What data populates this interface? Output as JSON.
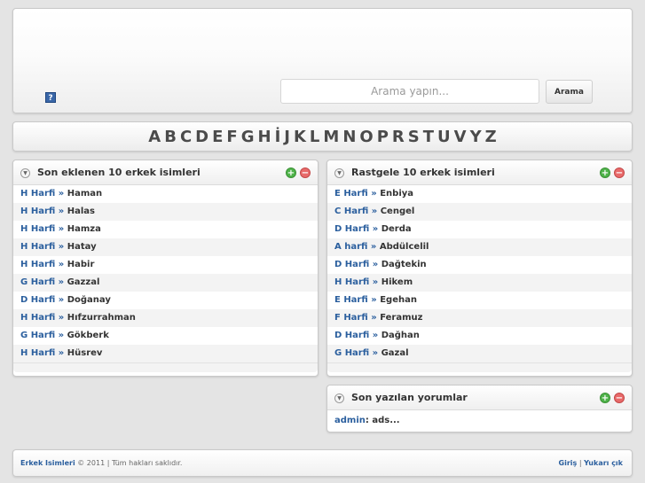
{
  "header": {
    "help_icon_glyph": "?",
    "search_placeholder": "Arama yapın...",
    "search_button": "Arama"
  },
  "alphabet": [
    "A",
    "B",
    "C",
    "D",
    "E",
    "F",
    "G",
    "H",
    "İ",
    "J",
    "K",
    "L",
    "M",
    "N",
    "O",
    "P",
    "R",
    "S",
    "T",
    "U",
    "V",
    "Y",
    "Z"
  ],
  "recent": {
    "title": "Son eklenen 10 erkek isimleri",
    "items": [
      {
        "harf": "H Harfi",
        "name": "Haman"
      },
      {
        "harf": "H Harfi",
        "name": "Halas"
      },
      {
        "harf": "H Harfi",
        "name": "Hamza"
      },
      {
        "harf": "H Harfi",
        "name": "Hatay"
      },
      {
        "harf": "H Harfi",
        "name": "Habir"
      },
      {
        "harf": "G Harfi",
        "name": "Gazzal"
      },
      {
        "harf": "D Harfi",
        "name": "Doğanay"
      },
      {
        "harf": "H Harfi",
        "name": "Hıfzurrahman"
      },
      {
        "harf": "G Harfi",
        "name": "Gökberk"
      },
      {
        "harf": "H Harfi",
        "name": "Hüsrev"
      }
    ]
  },
  "random": {
    "title": "Rastgele 10 erkek isimleri",
    "items": [
      {
        "harf": "E Harfi",
        "name": "Enbiya"
      },
      {
        "harf": "C Harfi",
        "name": "Cengel"
      },
      {
        "harf": "D Harfi",
        "name": "Derda"
      },
      {
        "harf": "A harfi",
        "name": "Abdülcelil"
      },
      {
        "harf": "D Harfi",
        "name": "Dağtekin"
      },
      {
        "harf": "H Harfi",
        "name": "Hikem"
      },
      {
        "harf": "E Harfi",
        "name": "Egehan"
      },
      {
        "harf": "F Harfi",
        "name": "Feramuz"
      },
      {
        "harf": "D Harfi",
        "name": "Dağhan"
      },
      {
        "harf": "G Harfi",
        "name": "Gazal"
      }
    ]
  },
  "separator": "»",
  "comments": {
    "title": "Son yazılan yorumlar",
    "items": [
      {
        "user": "admin",
        "text": ": ads..."
      }
    ]
  },
  "footer": {
    "site_link": "Erkek Isimleri",
    "copyright": " © 2011 | Tüm hakları saklıdır.",
    "login": "Giriş",
    "divider": " | ",
    "top": "Yukarı çık"
  },
  "icons": {
    "collapse": "chevron-down-icon",
    "add": "plus-icon",
    "remove": "minus-icon",
    "help": "help-icon"
  },
  "colors": {
    "link": "#2b5f9e",
    "background": "#e4e4e4",
    "add": "#4fb34a",
    "remove": "#e86a6a"
  }
}
